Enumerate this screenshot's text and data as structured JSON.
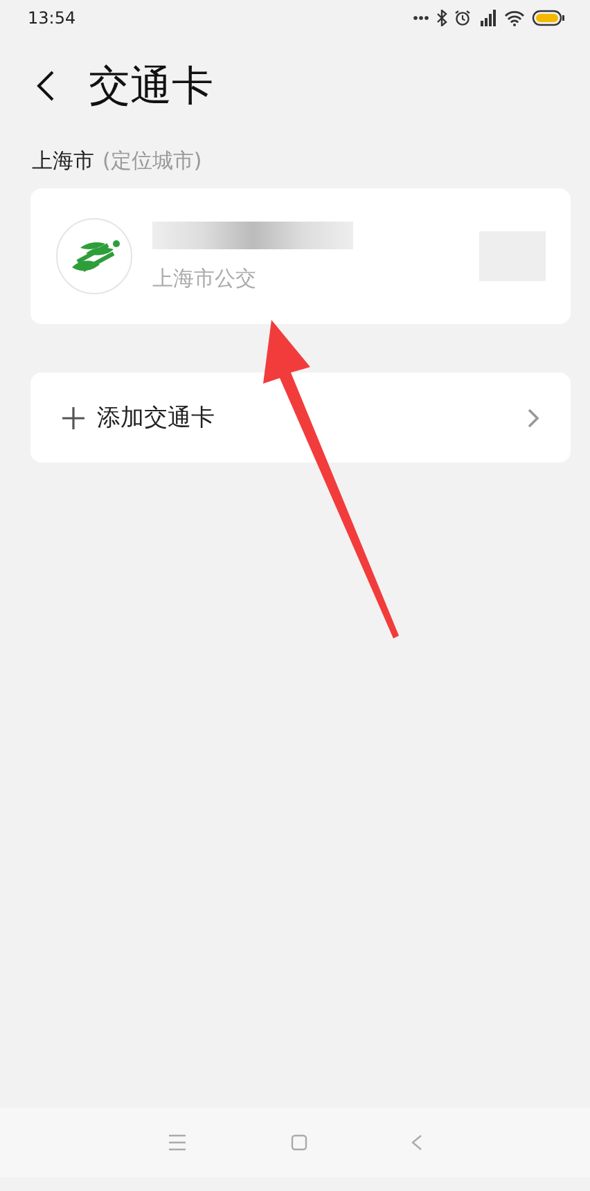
{
  "status_bar": {
    "time": "13:54"
  },
  "header": {
    "title": "交通卡"
  },
  "section": {
    "city": "上海市",
    "note": "(定位城市)"
  },
  "cards": [
    {
      "subtitle": "上海市公交"
    }
  ],
  "add_card": {
    "label": "添加交通卡"
  }
}
